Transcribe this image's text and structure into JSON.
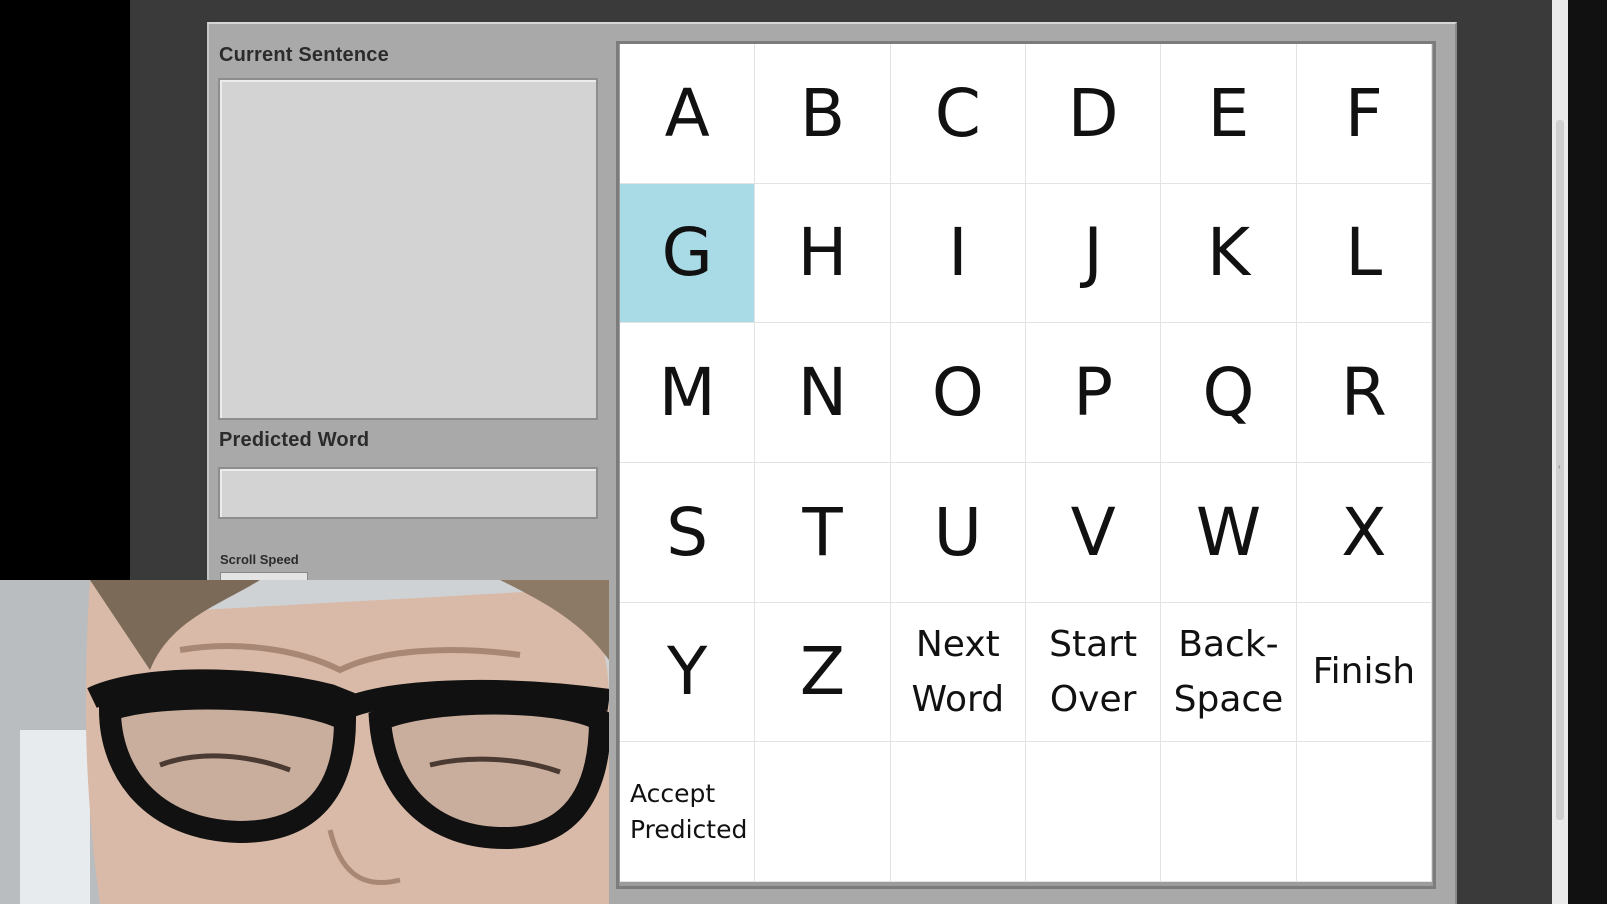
{
  "left_panel": {
    "current_sentence_label": "Current Sentence",
    "current_sentence_value": "",
    "predicted_word_label": "Predicted Word",
    "predicted_word_value": "",
    "scroll_speed_label": "Scroll Speed"
  },
  "keyboard": {
    "highlight_color": "#a8dbe6",
    "highlighted_key": "G",
    "keys": [
      {
        "label": "A",
        "kind": "letter"
      },
      {
        "label": "B",
        "kind": "letter"
      },
      {
        "label": "C",
        "kind": "letter"
      },
      {
        "label": "D",
        "kind": "letter"
      },
      {
        "label": "E",
        "kind": "letter"
      },
      {
        "label": "F",
        "kind": "letter"
      },
      {
        "label": "G",
        "kind": "letter"
      },
      {
        "label": "H",
        "kind": "letter"
      },
      {
        "label": "I",
        "kind": "letter"
      },
      {
        "label": "J",
        "kind": "letter"
      },
      {
        "label": "K",
        "kind": "letter"
      },
      {
        "label": "L",
        "kind": "letter"
      },
      {
        "label": "M",
        "kind": "letter"
      },
      {
        "label": "N",
        "kind": "letter"
      },
      {
        "label": "O",
        "kind": "letter"
      },
      {
        "label": "P",
        "kind": "letter"
      },
      {
        "label": "Q",
        "kind": "letter"
      },
      {
        "label": "R",
        "kind": "letter"
      },
      {
        "label": "S",
        "kind": "letter"
      },
      {
        "label": "T",
        "kind": "letter"
      },
      {
        "label": "U",
        "kind": "letter"
      },
      {
        "label": "V",
        "kind": "letter"
      },
      {
        "label": "W",
        "kind": "letter"
      },
      {
        "label": "X",
        "kind": "letter"
      },
      {
        "label": "Y",
        "kind": "letter"
      },
      {
        "label": "Z",
        "kind": "letter"
      },
      {
        "label": "Next\nWord",
        "kind": "word"
      },
      {
        "label": "Start\nOver",
        "kind": "word"
      },
      {
        "label": "Back-\nSpace",
        "kind": "word"
      },
      {
        "label": "Finish",
        "kind": "word"
      },
      {
        "label": "Accept\nPredicted",
        "kind": "small-word"
      },
      {
        "label": "",
        "kind": "empty"
      },
      {
        "label": "",
        "kind": "empty"
      },
      {
        "label": "",
        "kind": "empty"
      },
      {
        "label": "",
        "kind": "empty"
      },
      {
        "label": "",
        "kind": "empty"
      }
    ]
  },
  "webcam": {
    "icon": "webcam-feed-image"
  }
}
